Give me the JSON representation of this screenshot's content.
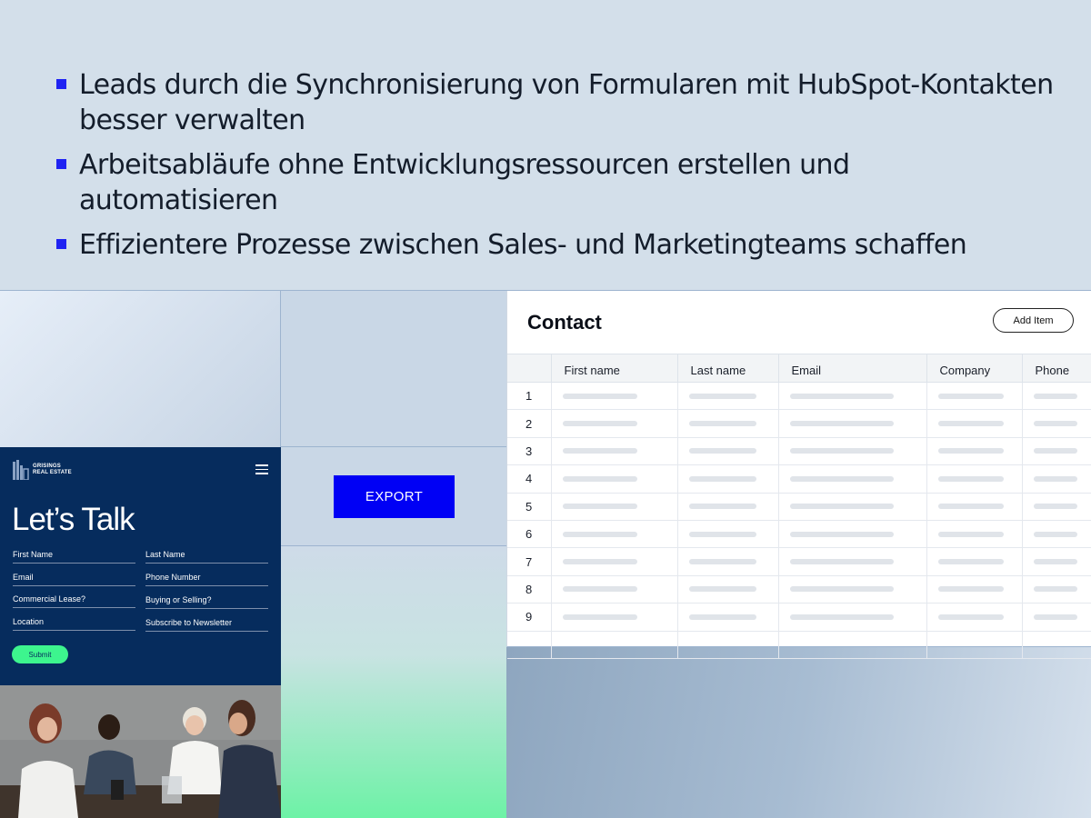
{
  "bullets": [
    "Leads durch die Synchronisierung von Formularen mit HubSpot-Kontakten besser verwalten",
    "Arbeitsabläufe ohne Entwicklungsressourcen erstellen und automatisieren",
    "Effizientere Prozesse zwischen Sales- und Marketingteams schaffen"
  ],
  "export_label": "EXPORT",
  "form": {
    "logo_line1": "GRISINGS",
    "logo_line2": "REAL ESTATE",
    "title": "Let’s Talk",
    "fields": [
      "First Name",
      "Last Name",
      "Email",
      "Phone Number",
      "Commercial Lease?",
      "Buying or Selling?",
      "Location",
      "Subscribe to Newsletter"
    ],
    "submit": "Submit"
  },
  "contact": {
    "title": "Contact",
    "add_item": "Add Item",
    "columns": [
      "First name",
      "Last name",
      "Email",
      "Company",
      "Phone"
    ],
    "rows": [
      "1",
      "2",
      "3",
      "4",
      "5",
      "6",
      "7",
      "8",
      "9"
    ]
  },
  "colors": {
    "accent": "#1f23f2",
    "export": "#0000f5",
    "form_bg": "#062c5d",
    "submit": "#3df58e"
  }
}
